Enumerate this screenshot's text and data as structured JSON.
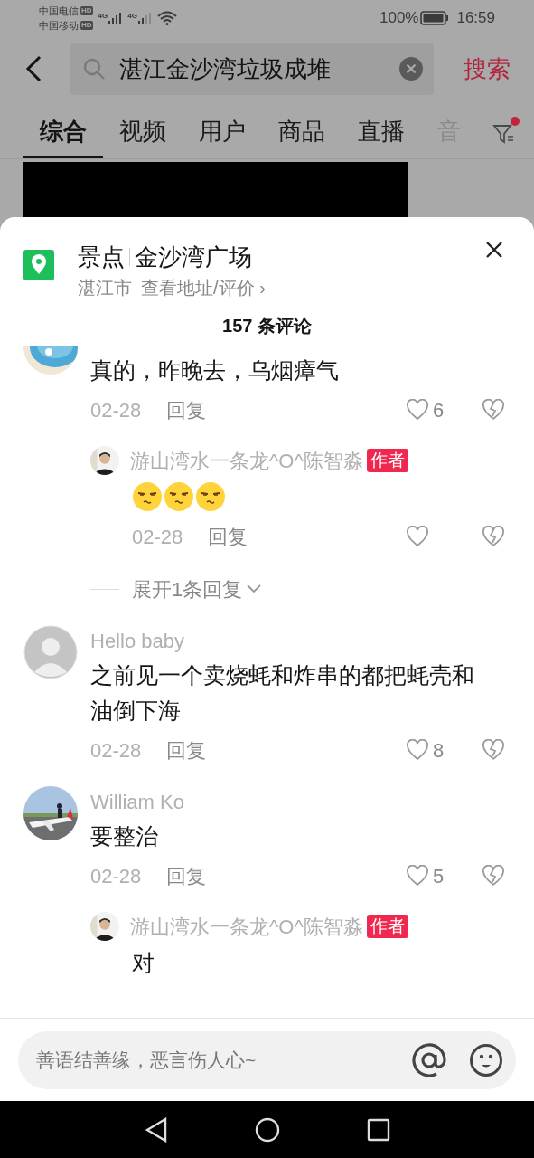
{
  "status_bar": {
    "carriers": [
      {
        "name": "中国电信",
        "badge": "HD"
      },
      {
        "name": "中国移动",
        "badge": "HD"
      }
    ],
    "network_labels": [
      "4G",
      "4G"
    ],
    "battery": "100%",
    "time": "16:59"
  },
  "search": {
    "value": "湛江金沙湾垃圾成堆",
    "submit": "搜索"
  },
  "tabs": [
    {
      "label": "综合",
      "selected": true
    },
    {
      "label": "视频",
      "selected": false
    },
    {
      "label": "用户",
      "selected": false
    },
    {
      "label": "商品",
      "selected": false
    },
    {
      "label": "直播",
      "selected": false
    },
    {
      "label": "音",
      "selected": false,
      "faded": true
    }
  ],
  "filter": {
    "has_notification": true
  },
  "sheet": {
    "category": "景点",
    "place": "金沙湾广场",
    "city": "湛江市",
    "link": "查看地址/评价",
    "link_arrow": "›",
    "comment_count": "157 条评论",
    "comments": [
      {
        "avatar": {
          "kind": "picture"
        },
        "clipped": true,
        "text": "真的，昨晚去，乌烟瘴气",
        "date": "02-28",
        "reply": "回复",
        "likes": "6",
        "replies": [
          {
            "name": "游山湾水一条龙^O^陈智淼",
            "badge": "作者",
            "emojis": [
              {
                "kind": "smirk"
              },
              {
                "kind": "smirk"
              },
              {
                "kind": "smirk"
              }
            ],
            "date": "02-28",
            "reply": "回复"
          }
        ],
        "expand": "展开1条回复"
      },
      {
        "avatar": {
          "kind": "default"
        },
        "name": "Hello baby",
        "text": "之前见一个卖烧蚝和炸串的都把蚝壳和油倒下海",
        "date": "02-28",
        "reply": "回复",
        "likes": "8"
      },
      {
        "avatar": {
          "kind": "picture"
        },
        "name": "William Ko",
        "text": "要整治",
        "date": "02-28",
        "reply": "回复",
        "likes": "5",
        "replies": [
          {
            "name": "游山湾水一条龙^O^陈智淼",
            "badge": "作者",
            "text": "对"
          }
        ]
      }
    ]
  },
  "input": {
    "placeholder": "善语结善缘，恶言伤人心~"
  }
}
